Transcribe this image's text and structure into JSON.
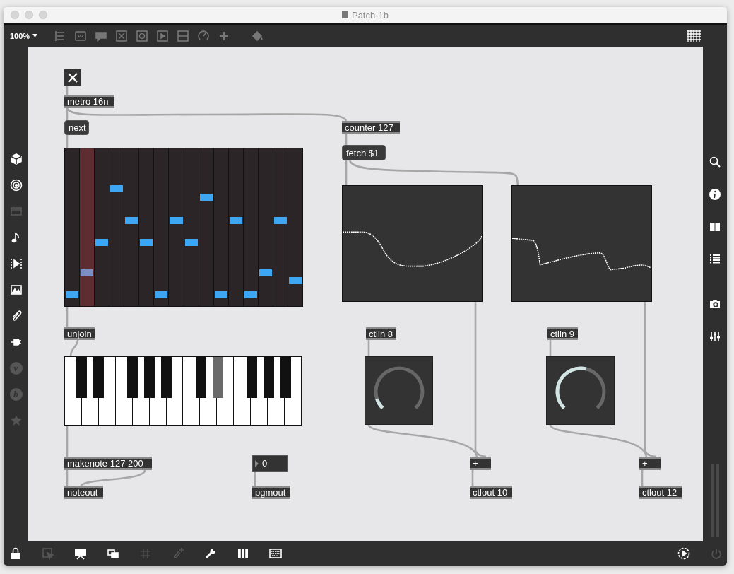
{
  "window": {
    "title": "Patch-1b"
  },
  "toolbar": {
    "zoom": "100%"
  },
  "left_sidebar": [
    {
      "disabled": false
    },
    {
      "disabled": false
    },
    {
      "disabled": true
    },
    {
      "disabled": false
    },
    {
      "disabled": false
    },
    {
      "disabled": false
    },
    {
      "disabled": false
    },
    {
      "disabled": false
    },
    {
      "disabled": true,
      "glyph": "v"
    },
    {
      "disabled": true,
      "glyph": "b"
    },
    {
      "disabled": true
    }
  ],
  "patch": {
    "objects": [
      {
        "kind": "toggle",
        "checked": true
      },
      {
        "kind": "object",
        "text": "metro 16n"
      },
      {
        "kind": "message",
        "text": "next"
      },
      {
        "kind": "object",
        "text": "counter 127"
      },
      {
        "kind": "message",
        "text": "fetch $1"
      },
      {
        "kind": "step_grid",
        "steps": [
          {
            "level": 0.05,
            "selected": false
          },
          {
            "level": 0.19,
            "selected": true
          },
          {
            "level": 0.38,
            "selected": false
          },
          {
            "level": 0.72,
            "selected": false
          },
          {
            "level": 0.52,
            "selected": false
          },
          {
            "level": 0.38,
            "selected": false
          },
          {
            "level": 0.05,
            "selected": false
          },
          {
            "level": 0.52,
            "selected": false
          },
          {
            "level": 0.38,
            "selected": false
          },
          {
            "level": 0.67,
            "selected": false
          },
          {
            "level": 0.05,
            "selected": false
          },
          {
            "level": 0.52,
            "selected": false
          },
          {
            "level": 0.05,
            "selected": false
          },
          {
            "level": 0.19,
            "selected": false
          },
          {
            "level": 0.52,
            "selected": false
          },
          {
            "level": 0.14,
            "selected": false
          }
        ]
      },
      {
        "kind": "object",
        "text": "unjoin"
      },
      {
        "kind": "keyboard",
        "black_keys": [
          {
            "selected": false
          },
          {
            "selected": false
          },
          {
            "selected": false
          },
          {
            "selected": false
          },
          {
            "selected": false
          },
          {
            "selected": false
          },
          {
            "selected": true
          },
          {
            "selected": false
          },
          {
            "selected": false
          },
          {
            "selected": false
          }
        ]
      },
      {
        "kind": "function_graph"
      },
      {
        "kind": "function_graph"
      },
      {
        "kind": "object",
        "text": "ctlin 8"
      },
      {
        "kind": "object",
        "text": "ctlin 9"
      },
      {
        "kind": "dial",
        "level": 0.1
      },
      {
        "kind": "dial",
        "level": 0.55
      },
      {
        "kind": "object",
        "text": "makenote 127 200"
      },
      {
        "kind": "object",
        "text": "noteout"
      },
      {
        "kind": "number",
        "text": "0"
      },
      {
        "kind": "object",
        "text": "pgmout"
      },
      {
        "kind": "object",
        "text": "+"
      },
      {
        "kind": "object",
        "text": "ctlout 10"
      },
      {
        "kind": "object",
        "text": "+"
      },
      {
        "kind": "object",
        "text": "ctlout 12"
      }
    ]
  },
  "bottom_toolbar": [
    {
      "disabled": false
    },
    {
      "disabled": true
    },
    {
      "disabled": false
    },
    {
      "disabled": false
    },
    {
      "disabled": true
    },
    {
      "disabled": true
    },
    {
      "disabled": false
    },
    {
      "disabled": false
    },
    {
      "disabled": false
    },
    {
      "disabled": false
    },
    {
      "disabled": true
    }
  ]
}
